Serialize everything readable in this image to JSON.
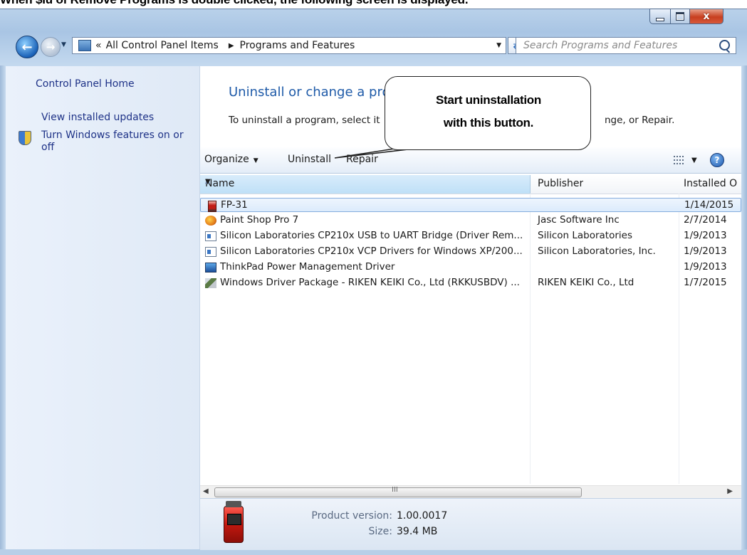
{
  "caption": "When $Iu of Remove Programs is double clicked, the following screen is displayed.",
  "window": {
    "address": {
      "root_label": "All Control Panel Items",
      "current_label": "Programs and Features"
    },
    "search_placeholder": "Search Programs and Features",
    "controls": {
      "minimize": "–",
      "maximize": "□",
      "close": "x"
    }
  },
  "sidebar": {
    "home": "Control Panel Home",
    "updates": "View installed updates",
    "features_line1": "Turn Windows features on or",
    "features_line2": "off"
  },
  "main": {
    "title": "Uninstall or change a program",
    "desc": "To uninstall a program, select it",
    "desc_tail": "nge, or Repair."
  },
  "toolbar": {
    "organize": "Organize",
    "uninstall": "Uninstall",
    "repair": "Repair",
    "help": "?"
  },
  "table": {
    "columns": [
      "Name",
      "Publisher",
      "Installed O"
    ],
    "rows": [
      {
        "name": "FP-31",
        "publisher": "",
        "installed": "1/14/2015",
        "icon": "fp31-device-icon",
        "selected": true
      },
      {
        "name": "Paint Shop Pro 7",
        "publisher": "Jasc Software Inc",
        "installed": "2/7/2014",
        "icon": "paint-shop-pro-icon"
      },
      {
        "name": "Silicon Laboratories CP210x USB to UART Bridge (Driver Rem...",
        "publisher": "Silicon Laboratories",
        "installed": "1/9/2013",
        "icon": "driver-icon"
      },
      {
        "name": "Silicon Laboratories CP210x VCP Drivers for Windows XP/200...",
        "publisher": "Silicon Laboratories, Inc.",
        "installed": "1/9/2013",
        "icon": "driver-icon"
      },
      {
        "name": "ThinkPad Power Management Driver",
        "publisher": "",
        "installed": "1/9/2013",
        "icon": "thinkpad-icon"
      },
      {
        "name": "Windows Driver Package - RIKEN KEIKI Co., Ltd (RKKUSBDV) ...",
        "publisher": "RIKEN KEIKI Co., Ltd",
        "installed": "1/7/2015",
        "icon": "driver-package-icon"
      }
    ]
  },
  "scrollbar": {
    "grip": "III"
  },
  "details": {
    "version_label": "Product version:",
    "version_value": "1.00.0017",
    "size_label": "Size:",
    "size_value": "39.4 MB"
  },
  "callout": {
    "line1": "Start uninstallation",
    "line2": "with this button."
  },
  "colors": {
    "link": "#1e3287",
    "title": "#1e5aa8",
    "selection_border": "#84acdd"
  }
}
